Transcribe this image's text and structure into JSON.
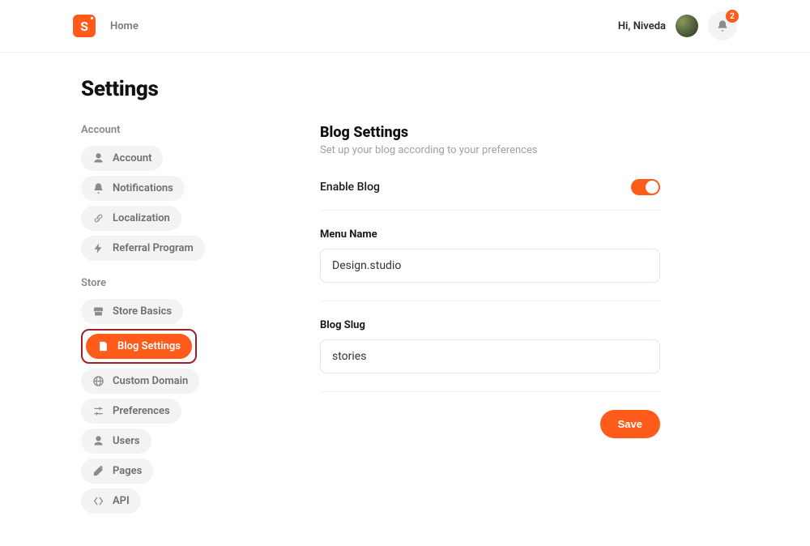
{
  "header": {
    "logo_letter": "S",
    "nav_home": "Home",
    "greeting": "Hi, Niveda",
    "notification_count": "2"
  },
  "page": {
    "title": "Settings"
  },
  "sidebar": {
    "sections": [
      {
        "label": "Account",
        "items": [
          {
            "id": "account",
            "label": "Account"
          },
          {
            "id": "notifications",
            "label": "Notifications"
          },
          {
            "id": "localization",
            "label": "Localization"
          },
          {
            "id": "referral",
            "label": "Referral Program"
          }
        ]
      },
      {
        "label": "Store",
        "items": [
          {
            "id": "store-basics",
            "label": "Store Basics"
          },
          {
            "id": "blog-settings",
            "label": "Blog Settings"
          },
          {
            "id": "custom-domain",
            "label": "Custom Domain"
          },
          {
            "id": "preferences",
            "label": "Preferences"
          },
          {
            "id": "users",
            "label": "Users"
          },
          {
            "id": "pages",
            "label": "Pages"
          },
          {
            "id": "api",
            "label": "API"
          }
        ]
      }
    ]
  },
  "content": {
    "title": "Blog Settings",
    "subtitle": "Set up your blog according to your preferences",
    "enable_blog_label": "Enable Blog",
    "enable_blog_value": true,
    "menu_name_label": "Menu Name",
    "menu_name_value": "Design.studio",
    "blog_slug_label": "Blog Slug",
    "blog_slug_value": "stories",
    "save_label": "Save"
  },
  "colors": {
    "accent": "#ff5b1a",
    "highlight_border": "#a12028"
  }
}
